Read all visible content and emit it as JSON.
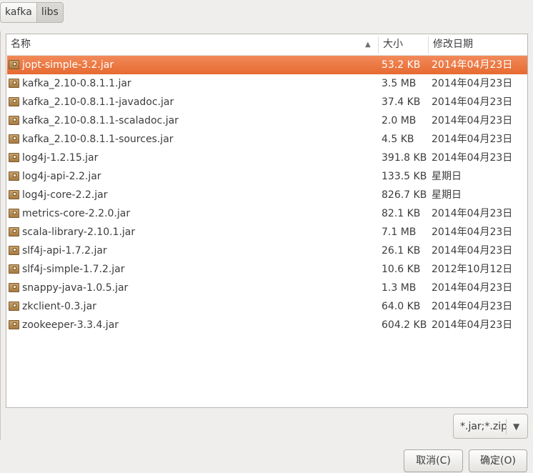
{
  "pathbar": {
    "items": [
      {
        "label": "kafka"
      },
      {
        "label": "libs"
      }
    ]
  },
  "columns": {
    "name": "名称",
    "size": "大小",
    "modified": "修改日期"
  },
  "files": [
    {
      "name": "jopt-simple-3.2.jar",
      "size": "53.2 KB",
      "modified": "2014年04月23日",
      "selected": true
    },
    {
      "name": "kafka_2.10-0.8.1.1.jar",
      "size": "3.5 MB",
      "modified": "2014年04月23日"
    },
    {
      "name": "kafka_2.10-0.8.1.1-javadoc.jar",
      "size": "37.4 KB",
      "modified": "2014年04月23日"
    },
    {
      "name": "kafka_2.10-0.8.1.1-scaladoc.jar",
      "size": "2.0 MB",
      "modified": "2014年04月23日"
    },
    {
      "name": "kafka_2.10-0.8.1.1-sources.jar",
      "size": "4.5 KB",
      "modified": "2014年04月23日"
    },
    {
      "name": "log4j-1.2.15.jar",
      "size": "391.8 KB",
      "modified": "2014年04月23日"
    },
    {
      "name": "log4j-api-2.2.jar",
      "size": "133.5 KB",
      "modified": "星期日"
    },
    {
      "name": "log4j-core-2.2.jar",
      "size": "826.7 KB",
      "modified": "星期日"
    },
    {
      "name": "metrics-core-2.2.0.jar",
      "size": "82.1 KB",
      "modified": "2014年04月23日"
    },
    {
      "name": "scala-library-2.10.1.jar",
      "size": "7.1 MB",
      "modified": "2014年04月23日"
    },
    {
      "name": "slf4j-api-1.7.2.jar",
      "size": "26.1 KB",
      "modified": "2014年04月23日"
    },
    {
      "name": "slf4j-simple-1.7.2.jar",
      "size": "10.6 KB",
      "modified": "2012年10月12日"
    },
    {
      "name": "snappy-java-1.0.5.jar",
      "size": "1.3 MB",
      "modified": "2014年04月23日"
    },
    {
      "name": "zkclient-0.3.jar",
      "size": "64.0 KB",
      "modified": "2014年04月23日"
    },
    {
      "name": "zookeeper-3.3.4.jar",
      "size": "604.2 KB",
      "modified": "2014年04月23日"
    }
  ],
  "file_icon": "jar-archive-icon",
  "filter": {
    "value": "*.jar;*.zip"
  },
  "buttons": {
    "cancel": "取消(C)",
    "ok": "确定(O)"
  },
  "colors": {
    "selection": "#e9743c"
  }
}
